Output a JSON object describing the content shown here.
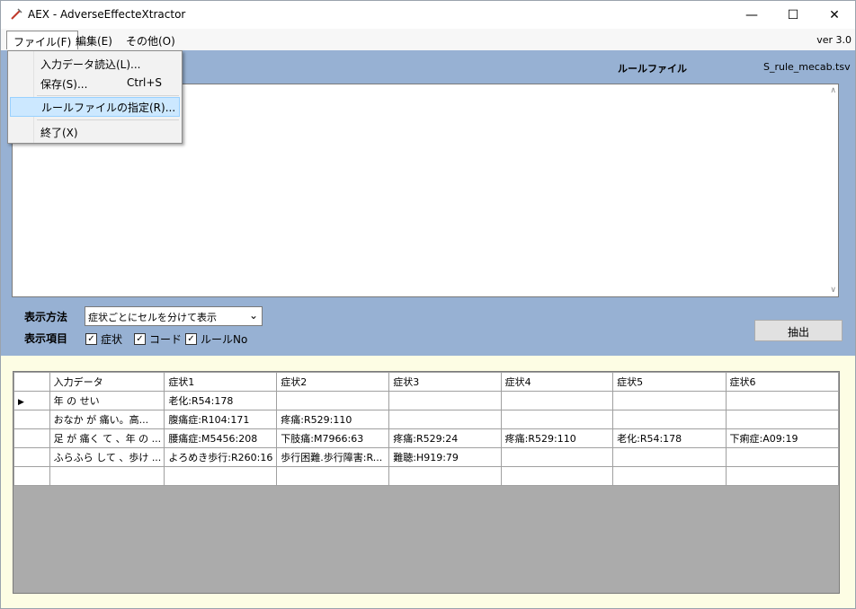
{
  "window": {
    "title": "AEX - AdverseEffecteXtractor"
  },
  "menubar": {
    "file": "ファイル(F)",
    "edit": "編集(E)",
    "other": "その他(O)",
    "version": "ver 3.0"
  },
  "file_menu": {
    "load": "入力データ読込(L)...",
    "save": "保存(S)...",
    "save_shortcut": "Ctrl+S",
    "rule": "ルールファイルの指定(R)...",
    "exit": "終了(X)"
  },
  "rule_file": {
    "label": "ルールファイル",
    "value": "S_rule_mecab.tsv"
  },
  "options": {
    "display_method_label": "表示方法",
    "display_method_value": "症状ごとにセルを分けて表示",
    "display_items_label": "表示項目",
    "check_symptom": "症状",
    "check_code": "コード",
    "check_ruleno": "ルールNo",
    "extract_button": "抽出"
  },
  "grid": {
    "headers": [
      "入力データ",
      "症状1",
      "症状2",
      "症状3",
      "症状4",
      "症状5",
      "症状6"
    ],
    "rows": [
      [
        "年 の せい",
        "老化:R54:178",
        "",
        "",
        "",
        "",
        ""
      ],
      [
        "おなか が 痛い。高...",
        "腹痛症:R104:171",
        "疼痛:R529:110",
        "",
        "",
        "",
        ""
      ],
      [
        "足 が 痛く て 、年 の ...",
        "腰痛症:M5456:208",
        "下肢痛:M7966:63",
        "疼痛:R529:24",
        "疼痛:R529:110",
        "老化:R54:178",
        "下痢症:A09:19"
      ],
      [
        "ふらふら して 、歩け ...",
        "よろめき歩行:R260:16",
        "歩行困難.歩行障害:R...",
        "難聴:H919:79",
        "",
        "",
        ""
      ]
    ]
  }
}
